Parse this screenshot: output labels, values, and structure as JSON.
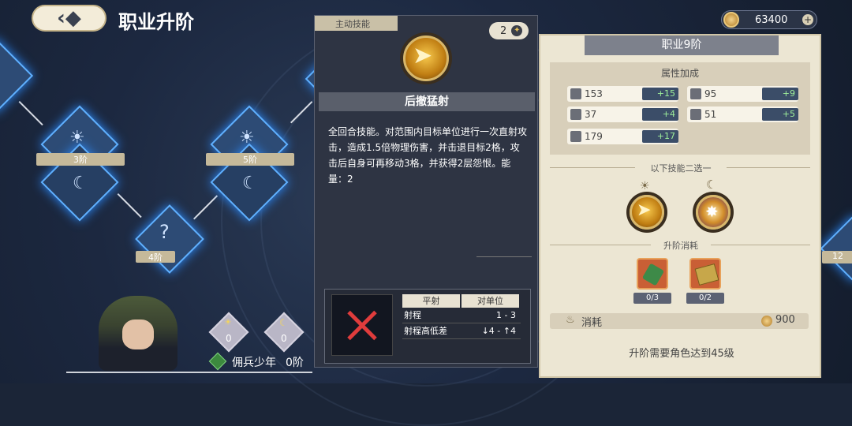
{
  "header": {
    "back_icon": "back-arrow-icon",
    "title": "职业升阶",
    "coins": "63400"
  },
  "tree": {
    "nodes": [
      {
        "label": "3阶"
      },
      {
        "label": "5阶"
      },
      {
        "label": "4阶"
      }
    ],
    "edge_right_label": "12"
  },
  "character": {
    "sun_count": "0",
    "moon_count": "0",
    "name": "佣兵少年",
    "rank": "0阶"
  },
  "skill": {
    "tag": "主动技能",
    "count": "2",
    "name": "后撤猛射",
    "description": "全回合技能。对范围内目标单位进行一次直射攻击，造成1.5倍物理伤害，并击退目标2格，攻击后自身可再移动3格，并获得2层怨恨。能量：2",
    "table": {
      "headers": [
        "平射",
        "对单位"
      ],
      "rows": [
        {
          "label": "射程",
          "value": "1 - 3"
        },
        {
          "label": "射程高低差",
          "value": "↓4 - ↑4"
        }
      ]
    }
  },
  "job": {
    "title": "职业9阶",
    "attr_title": "属性加成",
    "attrs": [
      {
        "icon": "sword-icon",
        "value": "153",
        "bonus": "+15"
      },
      {
        "icon": "staff-icon",
        "value": "95",
        "bonus": "+9"
      },
      {
        "icon": "shield-icon",
        "value": "37",
        "bonus": "+4"
      },
      {
        "icon": "boot-icon",
        "value": "51",
        "bonus": "+5"
      },
      {
        "icon": "heart-icon",
        "value": "179",
        "bonus": "+17"
      }
    ],
    "choose_label": "以下技能二选一",
    "cost_label": "升阶消耗",
    "materials": [
      {
        "count": "0/3"
      },
      {
        "count": "0/2"
      }
    ],
    "cost_name": "消耗",
    "cost_value": "900",
    "requirement": "升阶需要角色达到45级"
  }
}
